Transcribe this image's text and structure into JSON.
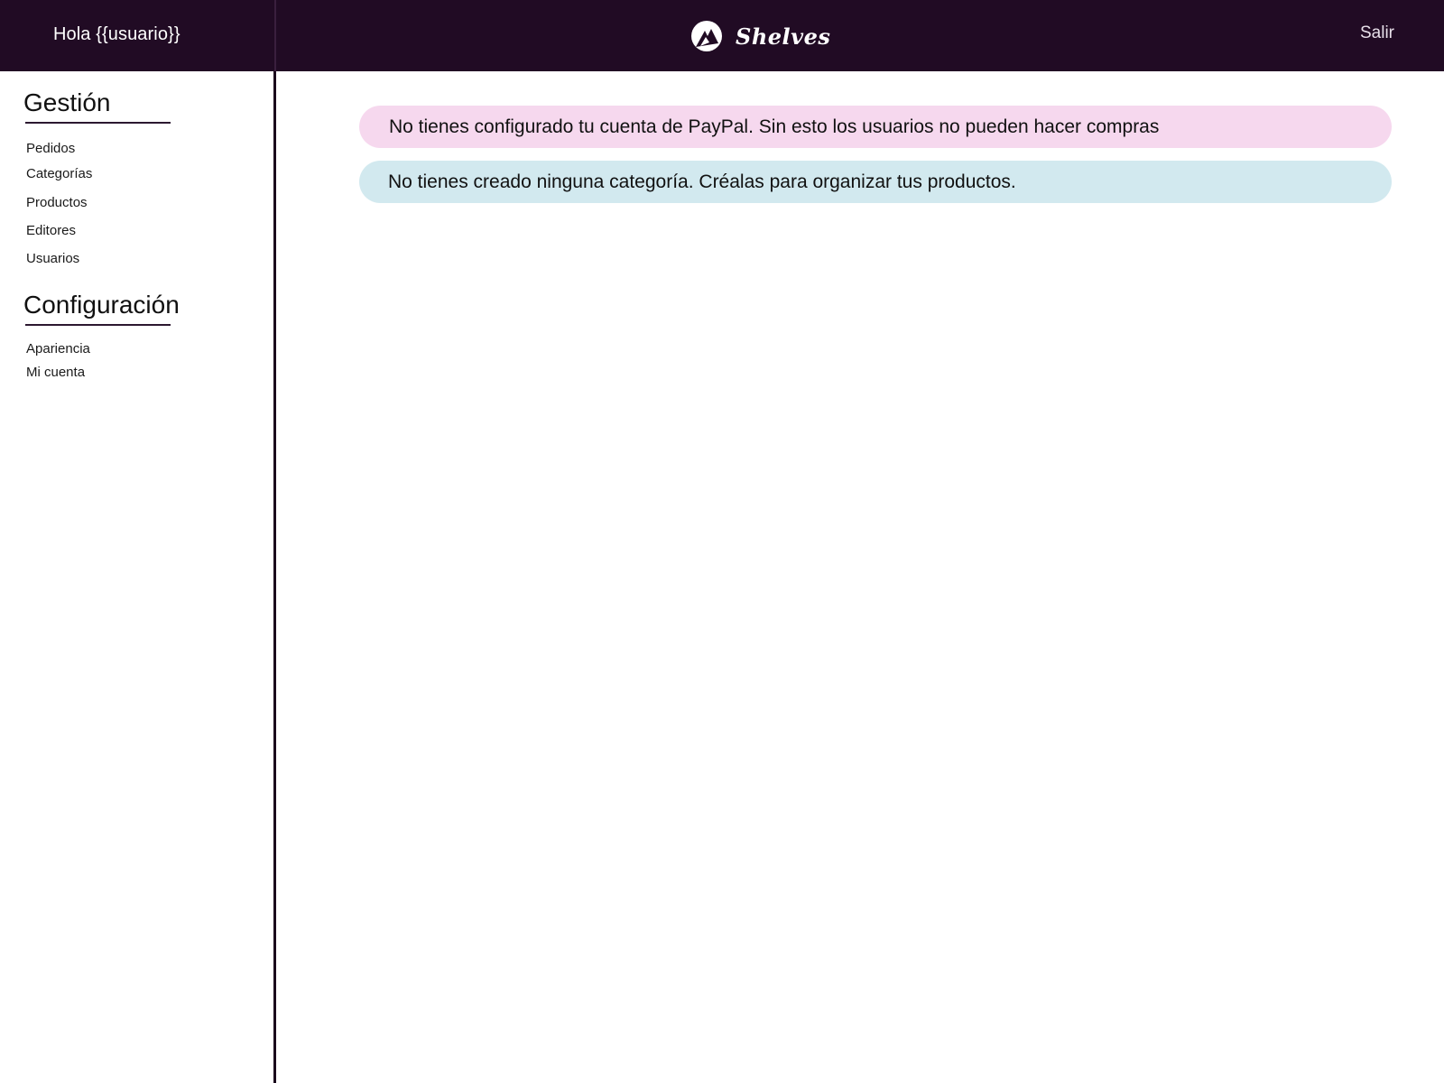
{
  "header": {
    "greeting": "Hola {{usuario}}",
    "brand": "Shelves",
    "logout_label": "Salir",
    "background": "#210b24"
  },
  "sidebar": {
    "sections": [
      {
        "title": "Gestión",
        "items": [
          "Pedidos",
          "Categorías",
          "Productos",
          "Editores",
          "Usuarios"
        ]
      },
      {
        "title": "Configuración",
        "items": [
          "Apariencia",
          "Mi cuenta"
        ]
      }
    ]
  },
  "alerts": [
    {
      "text": "No tienes configurado tu cuenta de PayPal. Sin esto los usuarios no pueden hacer compras",
      "color": "#f6d8ee"
    },
    {
      "text": "No tienes creado ninguna categoría. Créalas para organizar tus productos.",
      "color": "#d2e9ef"
    }
  ],
  "icons": {
    "logo": "shelves-logo-icon"
  }
}
